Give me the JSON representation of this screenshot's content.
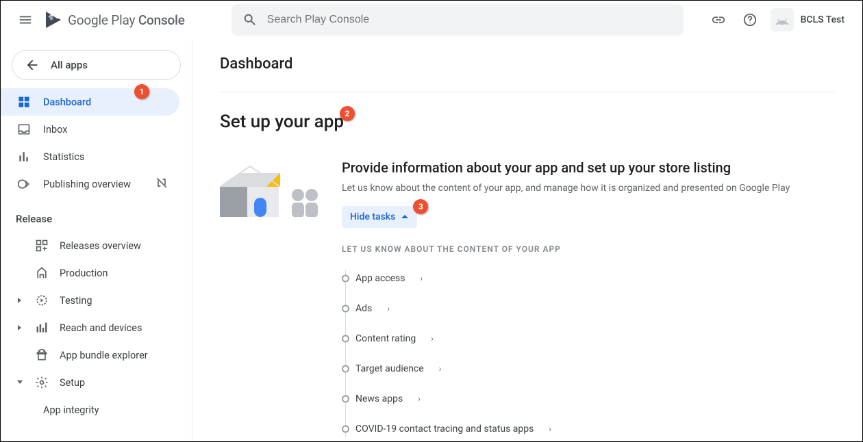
{
  "header": {
    "brand_prefix": "Google Play",
    "brand_suffix": "Console",
    "search_placeholder": "Search Play Console",
    "account_name": "BCLS Test"
  },
  "sidebar": {
    "all_apps": "All apps",
    "items": [
      {
        "label": "Dashboard"
      },
      {
        "label": "Inbox"
      },
      {
        "label": "Statistics"
      },
      {
        "label": "Publishing overview"
      }
    ],
    "release_header": "Release",
    "release_items": [
      {
        "label": "Releases overview"
      },
      {
        "label": "Production"
      },
      {
        "label": "Testing"
      },
      {
        "label": "Reach and devices"
      },
      {
        "label": "App bundle explorer"
      },
      {
        "label": "Setup"
      }
    ],
    "setup_sub": "App integrity"
  },
  "main": {
    "title": "Dashboard",
    "setup_title": "Set up your app",
    "section_heading": "Provide information about your app and set up your store listing",
    "section_desc": "Let us know about the content of your app, and manage how it is organized and presented on Google Play",
    "hide_tasks": "Hide tasks",
    "tasks_header": "LET US KNOW ABOUT THE CONTENT OF YOUR APP",
    "tasks": [
      "App access",
      "Ads",
      "Content rating",
      "Target audience",
      "News apps",
      "COVID-19 contact tracing and status apps"
    ]
  },
  "badges": {
    "b1": "1",
    "b2": "2",
    "b3": "3"
  }
}
